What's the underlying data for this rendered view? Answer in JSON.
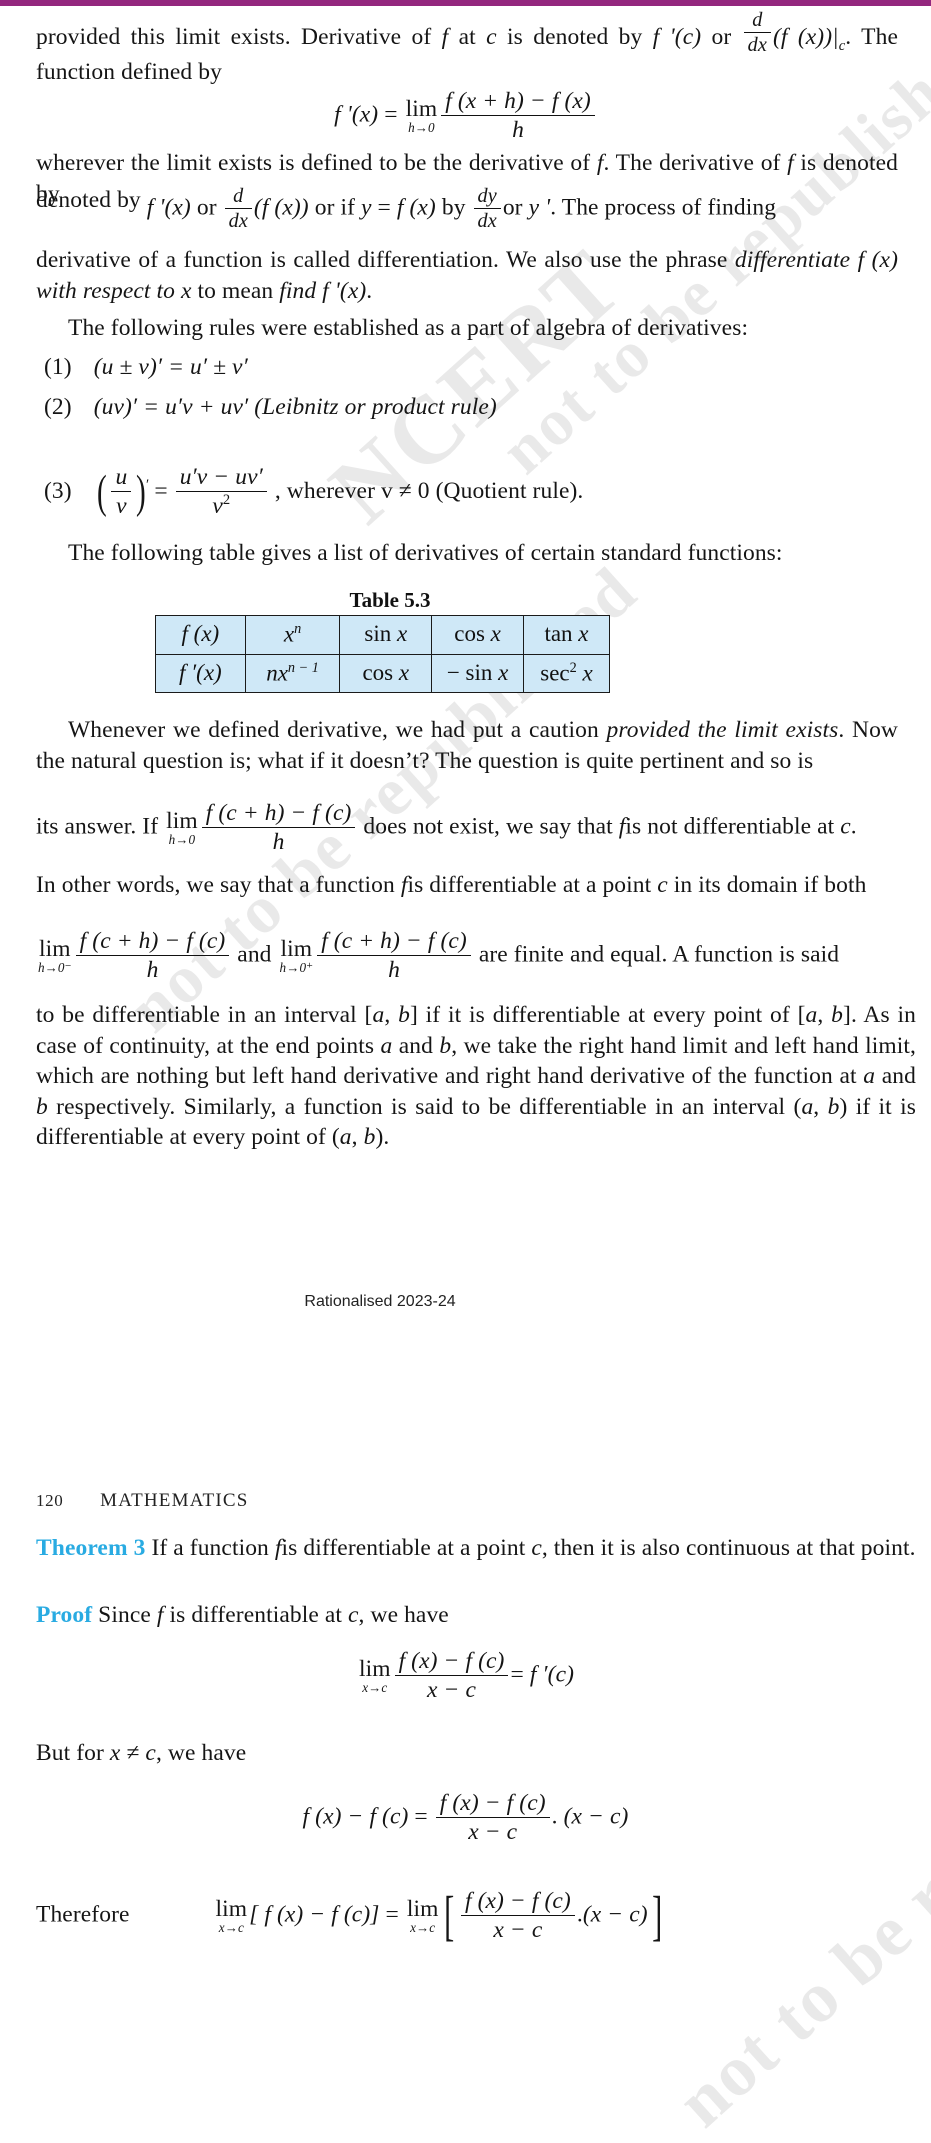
{
  "document": {
    "subject_header": "MATHEMATICS",
    "page_number": "120",
    "footer_note": "Rationalised 2023-24",
    "accent_bar_color": "#93277e",
    "theorem_label_color": "#29abe2",
    "table_fill_color": "#cfe8f7"
  },
  "watermarks": {
    "w1": "NCERT",
    "w2": "not to be republished",
    "w3": "©"
  },
  "body": {
    "p1_a": "provided this limit exists. Derivative of",
    "p1_f": "f",
    "p1_b": "at",
    "p1_c": "c",
    "p1_d": "is denoted by",
    "p1_fprime": "f '(c)",
    "p1_or": "or",
    "p1_ddx_num": "d",
    "p1_ddx_den": "dx",
    "p1_fx": "(f (x))|",
    "p1_sub_c": "c",
    "p1_e": ". The function defined by",
    "eq1": {
      "lhs": "f '(x)",
      "eq": "=",
      "lim": "lim",
      "lim_sub": "h→0",
      "num": "f (x + h) − f (x)",
      "den": "h"
    },
    "p2": "wherever the limit exists is defined to be the derivative of",
    "p2_f": "f",
    "p2_b": ". The derivative of",
    "p2_f2": "f",
    "p2_c": "is denoted by",
    "p2_fprime": "f '(x)",
    "p2_or1": "or",
    "p2_ddx_num": "d",
    "p2_ddx_den": "dx",
    "p2_fx": "(f (x))",
    "p2_or2": "or if",
    "p2_y": "y",
    "p2_eq": "=",
    "p2_fx2": "f (x)",
    "p2_by": "by",
    "p2_dydx_num": "dy",
    "p2_dydx_den": "dx",
    "p2_or3": "or",
    "p2_yprime": "y '",
    "p2_tail": ". The process of finding derivative of a function is called differentiation. We also use the phrase",
    "p2_em1": "differentiate f (x) with respect to x",
    "p2_mid": "to mean",
    "p2_em2": "find f '(x)",
    "p2_end": ".",
    "p3": "The following rules were established as a part of algebra of derivatives:",
    "rules": [
      {
        "num": "(1)",
        "text": "(u ± v)′ = u′ ± v′"
      },
      {
        "num": "(2)",
        "text": "(uv)′ = u′v + uv′ (Leibnitz or product rule)"
      },
      {
        "num": "(3)",
        "text_lead": "",
        "frac_num": "u",
        "frac_den": "v",
        "prime": "′",
        "eq": "=",
        "rhs_num": "u′v − uv′",
        "rhs_den": "v",
        "rhs_den_sup": "2",
        "tail": ", wherever v ≠ 0 (Quotient rule)."
      }
    ],
    "p4": "The following table gives a list of derivatives of certain standard functions:",
    "p5_a": "Whenever we defined derivative, we had put a caution",
    "p5_em": "provided the limit exists",
    "p5_b": ". Now the natural question is; what if it doesn’t? The question is quite pertinent and so is its answer. If",
    "p5_lim": "lim",
    "p5_lim_sub": "h→0",
    "p5_num": "f (c + h) − f (c)",
    "p5_den": "h",
    "p5_c": "does not exist, we say that",
    "p5_f": "f",
    "p5_d": "is not differentiable at",
    "p5_cc": "c",
    "p5_e": ".",
    "p6": "In other words, we say that a function",
    "p6_f": "f",
    "p6_b": "is differentiable at a point",
    "p6_c": "c",
    "p6_d": "in its domain if both",
    "p7": {
      "lim1": "lim",
      "lim1_sub": "h→0⁻",
      "num": "f (c + h) − f (c)",
      "den": "h",
      "and": "and",
      "lim2": "lim",
      "lim2_sub": "h→0⁺",
      "tail": "are finite and equal. A function is said"
    },
    "p8": "to be differentiable in an interval [a, b] if it is differentiable at every point of [a, b]. As in case of continuity, at the end points a and b, we take the right hand limit and left hand limit, which are nothing but left hand derivative and right hand derivative of the function at a and b respectively. Similarly, a function is said to be differentiable in an interval (a, b) if it is differentiable at every point of (a, b).",
    "theorem": {
      "label": "Theorem 3",
      "text_a": "If a function",
      "text_f": "f",
      "text_b": "is differentiable at a point",
      "text_c": "c",
      "text_d": ", then it is also continuous at that point."
    },
    "proof": {
      "label": "Proof",
      "text_a": "Since",
      "text_f": "f",
      "text_b": "is differentiable at",
      "text_c": "c",
      "text_d": ", we have"
    },
    "eq2": {
      "lim": "lim",
      "lim_sub": "x→c",
      "num": "f (x) − f (c)",
      "den": "x − c",
      "eq": "=",
      "rhs": "f ′(c)"
    },
    "p9_a": "But for",
    "p9_x": "x ≠ c",
    "p9_b": ", we have",
    "eq3": {
      "lhs": "f (x) − f (c)",
      "eq": "=",
      "num": "f (x) − f (c)",
      "den": "x − c",
      "dot": ".",
      "rhs": "(x − c)"
    },
    "eq4": {
      "lead": "Therefore",
      "lim": "lim",
      "lim_sub": "x→c",
      "lhs": "[ f (x) − f (c)]",
      "eq": "=",
      "lim2": "lim",
      "lim2_sub": "x→c",
      "num": "f (x) − f (c)",
      "den": "x − c",
      "dot": ".",
      "rhs": "(x − c)"
    }
  },
  "table_5_3": {
    "caption": "Table 5.3",
    "rows": [
      {
        "header": "f (x)",
        "cells": [
          "x",
          "sin x",
          "cos x",
          "tan x"
        ],
        "cell0_sup": "n"
      },
      {
        "header": "f ′(x)",
        "cells": [
          "nx",
          "cos x",
          "− sin x",
          "sec"
        ],
        "cell0_sup": "n − 1",
        "cell3_sup": "2",
        "cell3_tail": " x"
      }
    ]
  }
}
